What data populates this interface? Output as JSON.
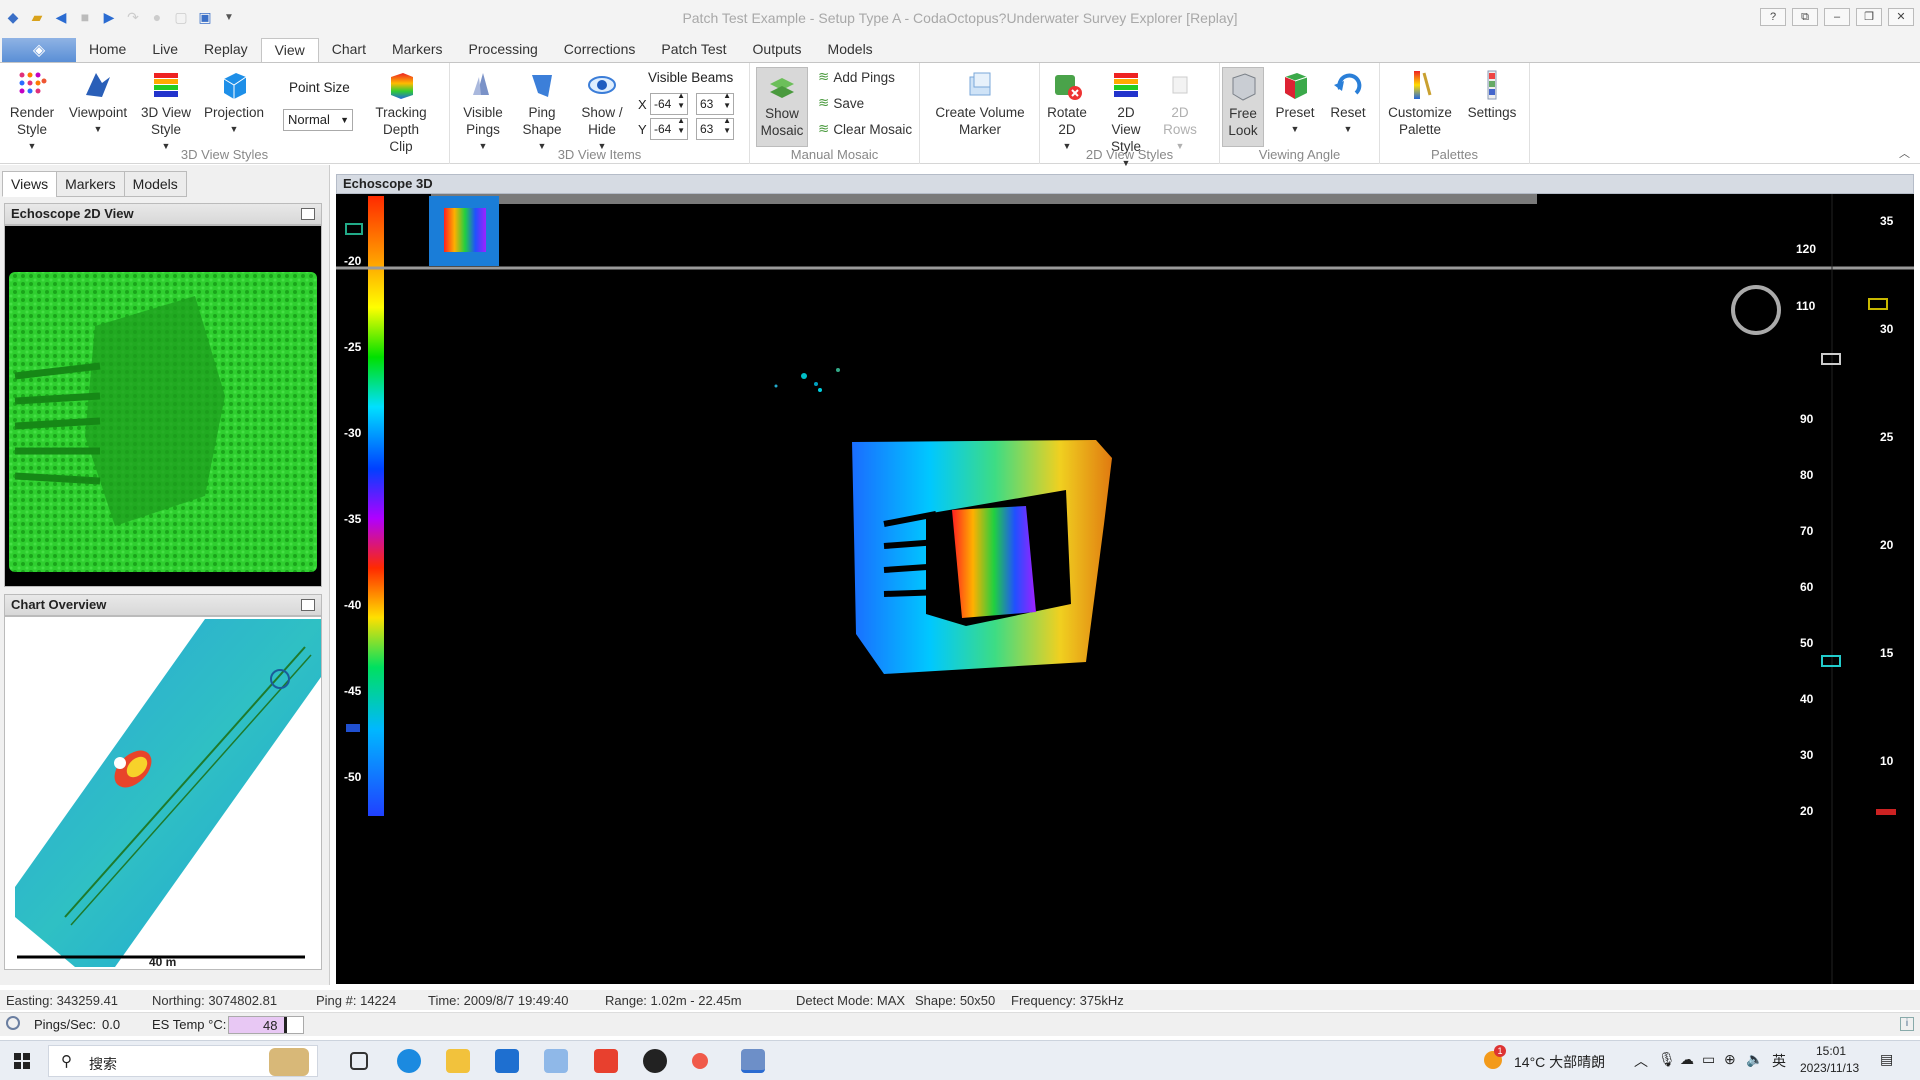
{
  "window": {
    "title": "Patch Test Example - Setup Type A - CodaOctopus?Underwater Survey Explorer [Replay]"
  },
  "ribbon_tabs": [
    "Home",
    "Live",
    "Replay",
    "View",
    "Chart",
    "Markers",
    "Processing",
    "Corrections",
    "Patch Test",
    "Outputs",
    "Models"
  ],
  "active_tab": "View",
  "ribbon": {
    "groups": {
      "styles3d": "3D View Styles",
      "items3d": "3D View Items",
      "mosaic": "Manual Mosaic",
      "styles2d": "2D View Styles",
      "angle": "Viewing Angle",
      "palettes": "Palettes"
    },
    "render_style": "Render Style",
    "viewpoint": "Viewpoint",
    "view_style3d": "3D View Style",
    "projection": "Projection",
    "point_size_label": "Point Size",
    "point_size_value": "Normal",
    "tracking_clip": "Tracking Depth Clip",
    "visible_pings": "Visible Pings",
    "ping_shape": "Ping Shape",
    "show_hide": "Show / Hide",
    "visible_beams": "Visible Beams",
    "beam_x_label": "X",
    "beam_y_label": "Y",
    "beam_x_min": "-64",
    "beam_x_max": "63",
    "beam_y_min": "-64",
    "beam_y_max": "63",
    "show_mosaic": "Show Mosaic",
    "add_pings": "Add Pings",
    "save": "Save",
    "clear_mosaic": "Clear Mosaic",
    "create_volume_marker": "Create Volume Marker",
    "rotate2d": "Rotate 2D",
    "view_style2d": "2D View Style",
    "rows2d": "2D Rows",
    "free_look": "Free Look",
    "preset": "Preset",
    "reset": "Reset",
    "customize_palette": "Customize Palette",
    "settings": "Settings"
  },
  "left_panel": {
    "tabs": [
      "Views",
      "Markers",
      "Models"
    ],
    "active_tab": "Views",
    "echoscope2d_title": "Echoscope 2D View",
    "chart_overview_title": "Chart Overview",
    "scale_label": "40 m"
  },
  "main_view": {
    "title": "Echoscope 3D",
    "depth_ticks": [
      "-20",
      "-25",
      "-30",
      "-35",
      "-40",
      "-45",
      "-50"
    ],
    "right_ticks_outer": [
      "35",
      "30",
      "25",
      "20",
      "15",
      "10"
    ],
    "right_ticks_inner": [
      "120",
      "110",
      "90",
      "80",
      "70",
      "60",
      "50",
      "40",
      "30",
      "20"
    ]
  },
  "status": {
    "easting": "Easting: 343259.41",
    "northing": "Northing: 3074802.81",
    "ping": "Ping #: 14224",
    "time": "Time: 2009/8/7 19:49:40",
    "range": "Range: 1.02m - 22.45m",
    "detect_mode": "Detect Mode: MAX",
    "shape": "Shape: 50x50",
    "frequency": "Frequency: 375kHz",
    "pings_sec_label": "Pings/Sec:",
    "pings_sec_value": "0.0",
    "es_temp_label": "ES Temp °C:",
    "es_temp_value": "48"
  },
  "taskbar": {
    "search": "搜索",
    "weather": "14°C 大部晴朗",
    "ime": "英",
    "time": "15:01",
    "date": "2023/11/13",
    "weather_badge": "1"
  }
}
